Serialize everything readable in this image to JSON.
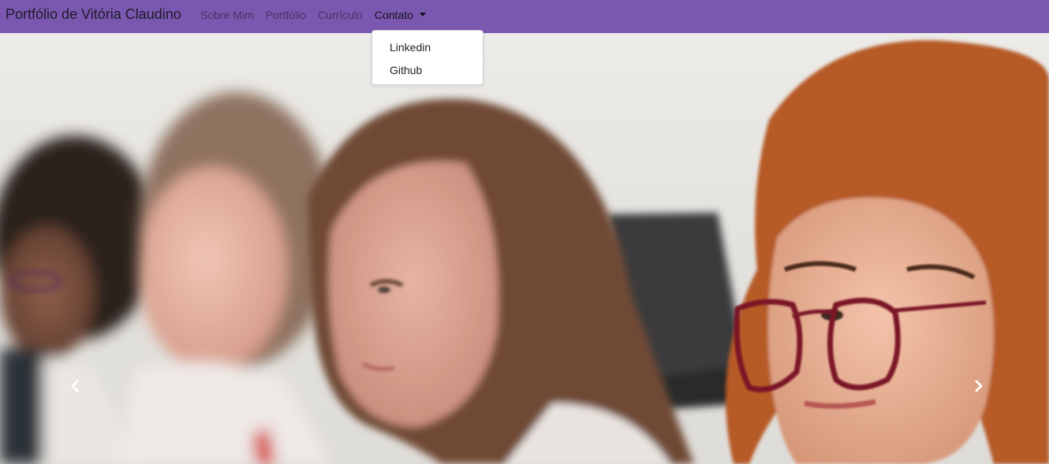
{
  "navbar": {
    "brand": "Portfólio de Vitória Claudino",
    "links": [
      {
        "label": "Sobre Mim"
      },
      {
        "label": "Portfólio"
      },
      {
        "label": "Currículo"
      },
      {
        "label": "Contato"
      }
    ],
    "background": "#7a58b0"
  },
  "dropdown": {
    "items": [
      {
        "label": "Linkedin"
      },
      {
        "label": "Github"
      }
    ]
  },
  "carousel": {
    "prev_icon": "chevron-left-icon",
    "next_icon": "chevron-right-icon"
  }
}
